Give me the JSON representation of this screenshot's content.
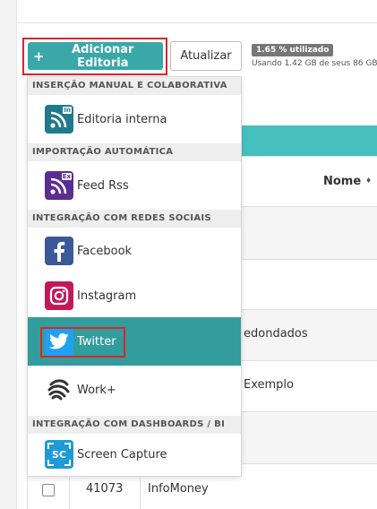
{
  "toolbar": {
    "add_label": "Adicionar Editoria",
    "add_plus": "+",
    "refresh_label": "Atualizar",
    "usage_badge": "1.65 % utilizado",
    "usage_text": "Usando 1.42 GB de seus 86 GB"
  },
  "table": {
    "column_name": "Nome",
    "sort_glyph": "♦",
    "rows": [
      {
        "text": "edondados"
      },
      {
        "text": "Exemplo"
      }
    ],
    "last_row": {
      "id": "41073",
      "name": "InfoMoney"
    }
  },
  "dropdown": {
    "sections": [
      {
        "label": "INSERÇÃO MANUAL E COLABORATIVA"
      },
      {
        "label": "IMPORTAÇÃO AUTOMÁTICA"
      },
      {
        "label": "INTEGRAÇÃO COM REDES SOCIAIS"
      },
      {
        "label": "INTEGRAÇÃO COM DASHBOARDS / BI"
      }
    ],
    "items": [
      {
        "label": "Editoria interna",
        "icon": "rss-in-icon",
        "tag": "In",
        "color": "#1f7a8c"
      },
      {
        "label": "Feed Rss",
        "icon": "rss-ex-icon",
        "tag": "Ex",
        "color": "#5b2c91"
      },
      {
        "label": "Facebook",
        "icon": "facebook-icon",
        "color": "#3b5998"
      },
      {
        "label": "Instagram",
        "icon": "instagram-icon",
        "color": "#c2185b"
      },
      {
        "label": "Twitter",
        "icon": "twitter-icon",
        "color": "#1da1f2"
      },
      {
        "label": "Work+",
        "icon": "work-plus-icon",
        "color": "#333333"
      },
      {
        "label": "Screen Capture",
        "icon": "screen-capture-icon",
        "tag": "SC",
        "color": "#1d9bd7"
      }
    ],
    "active_item": "Twitter"
  },
  "colors": {
    "accent": "#3aa8a8",
    "active_row": "#339c9c",
    "table_header": "#47bfbf",
    "highlight": "#d9262c"
  }
}
